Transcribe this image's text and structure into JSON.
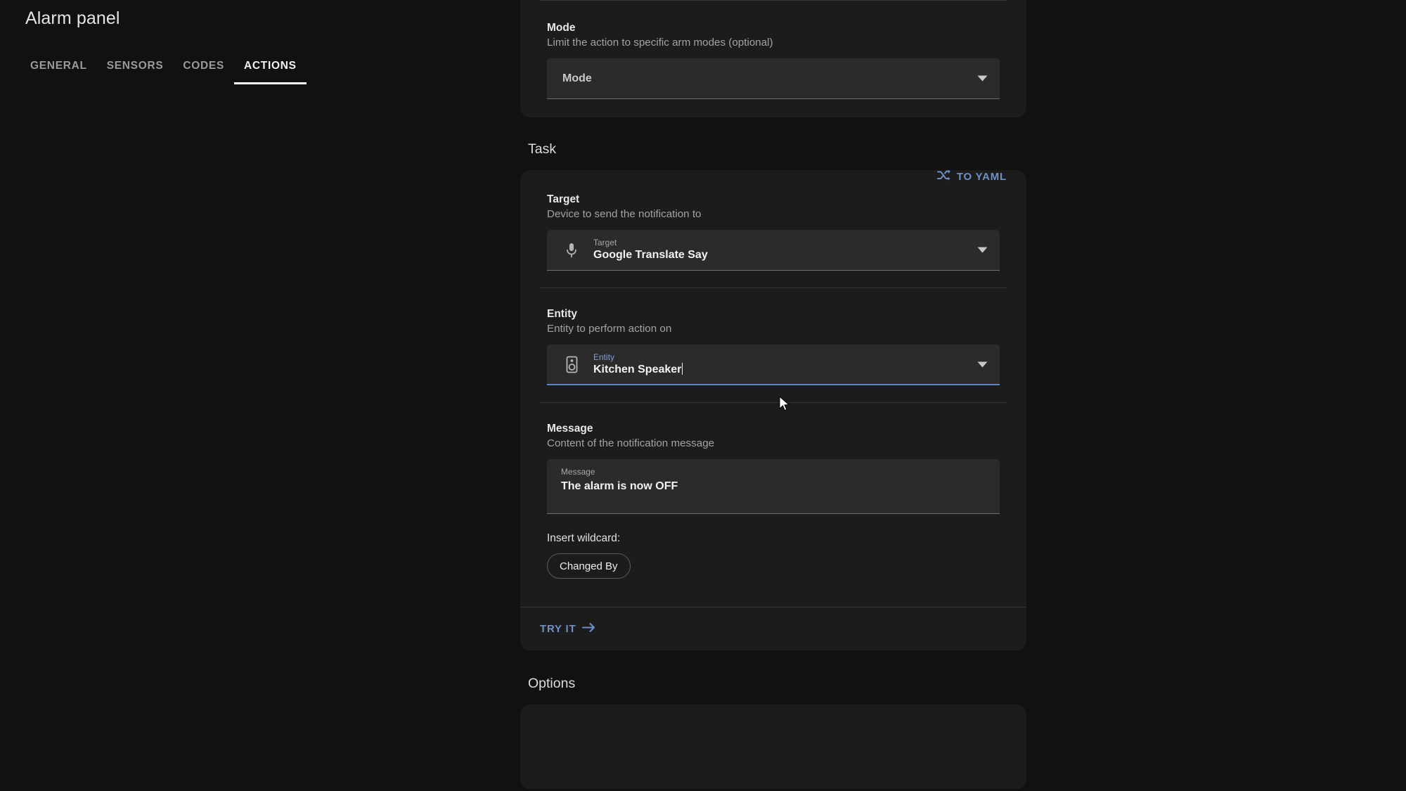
{
  "header": {
    "title": "Alarm panel",
    "tabs": [
      {
        "label": "GENERAL",
        "active": false
      },
      {
        "label": "SENSORS",
        "active": false
      },
      {
        "label": "CODES",
        "active": false
      },
      {
        "label": "ACTIONS",
        "active": true
      }
    ]
  },
  "mode_card": {
    "label": "Mode",
    "description": "Limit the action to specific arm modes (optional)",
    "select_value": "Mode",
    "dropdown_icon": "chevron-down-icon"
  },
  "task": {
    "heading": "Task",
    "to_yaml": {
      "label": "TO YAML",
      "icon": "shuffle-icon"
    },
    "target": {
      "label": "Target",
      "description": "Device to send the notification to",
      "float_label": "Target",
      "value": "Google Translate Say",
      "icon": "microphone-icon",
      "dropdown_icon": "chevron-down-icon"
    },
    "entity": {
      "label": "Entity",
      "description": "Entity to perform action on",
      "float_label": "Entity",
      "value": "Kitchen Speaker",
      "icon": "speaker-icon",
      "dropdown_icon": "chevron-down-icon",
      "focused": true
    },
    "message": {
      "label": "Message",
      "description": "Content of the notification message",
      "float_label": "Message",
      "value": "The alarm is now OFF"
    },
    "wildcard": {
      "label": "Insert wildcard:",
      "chips": [
        "Changed By"
      ]
    },
    "try_it": {
      "label": "TRY IT",
      "icon": "arrow-right-icon"
    }
  },
  "options": {
    "heading": "Options"
  },
  "colors": {
    "page_background": "#111111",
    "card_background": "#1c1c1c",
    "field_background": "#2b2b2b",
    "accent_blue": "#6e8fc9",
    "focus_underline": "#5b85c9",
    "text_primary": "#f2f2f2",
    "text_secondary": "#a3a3a3"
  }
}
